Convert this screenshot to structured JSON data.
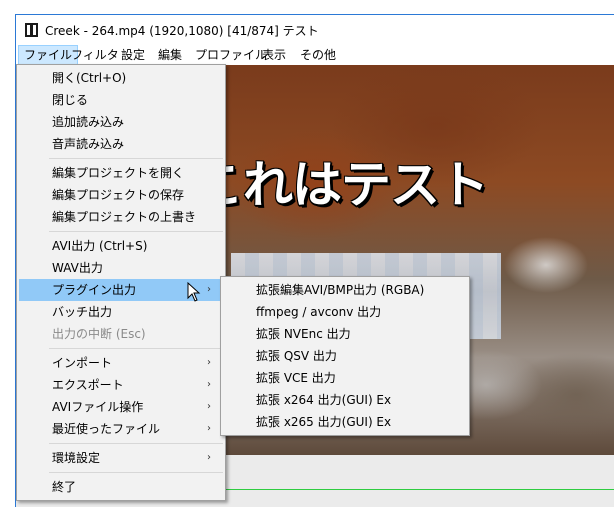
{
  "window": {
    "title": "Creek - 264.mp4 (1920,1080)  [41/874]  テスト"
  },
  "menubar": {
    "items": [
      "ファイル",
      "フィルタ",
      "設定",
      "編集",
      "プロファイル",
      "表示",
      "その他"
    ]
  },
  "preview": {
    "overlay_text": "これはテスト"
  },
  "file_menu": {
    "items": [
      {
        "label": "開く(Ctrl+O)"
      },
      {
        "label": "閉じる"
      },
      {
        "label": "追加読み込み"
      },
      {
        "label": "音声読み込み"
      },
      {
        "label": "編集プロジェクトを開く"
      },
      {
        "label": "編集プロジェクトの保存"
      },
      {
        "label": "編集プロジェクトの上書き"
      },
      {
        "label": "AVI出力 (Ctrl+S)"
      },
      {
        "label": "WAV出力"
      },
      {
        "label": "プラグイン出力"
      },
      {
        "label": "バッチ出力"
      },
      {
        "label": "出力の中断 (Esc)"
      },
      {
        "label": "インポート"
      },
      {
        "label": "エクスポート"
      },
      {
        "label": "AVIファイル操作"
      },
      {
        "label": "最近使ったファイル"
      },
      {
        "label": "環境設定"
      },
      {
        "label": "終了"
      }
    ]
  },
  "plugin_submenu": {
    "items": [
      {
        "label": "拡張編集AVI/BMP出力 (RGBA)"
      },
      {
        "label": "ffmpeg / avconv 出力"
      },
      {
        "label": "拡張 NVEnc 出力"
      },
      {
        "label": "拡張 QSV 出力"
      },
      {
        "label": "拡張 VCE 出力"
      },
      {
        "label": "拡張 x264 出力(GUI) Ex"
      },
      {
        "label": "拡張 x265 出力(GUI) Ex"
      }
    ]
  },
  "icons": {
    "submenu_arrow": "›"
  },
  "colors": {
    "highlight": "#91c9f7",
    "menubar_active": "#cce8ff",
    "timeline_line": "#2ecc40"
  }
}
